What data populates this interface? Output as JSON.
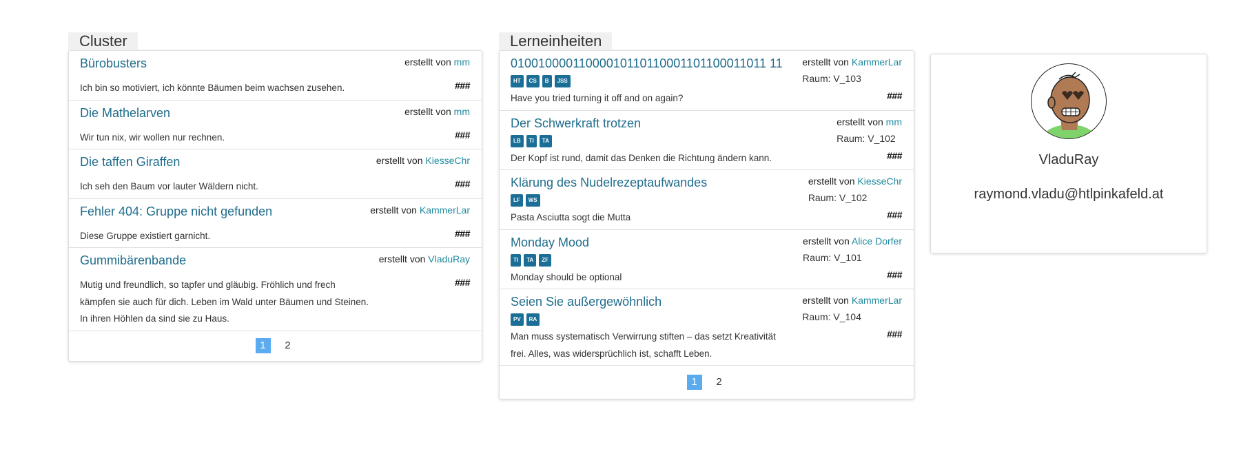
{
  "cluster": {
    "title": "Cluster",
    "created_by_label": "erstellt von",
    "items": [
      {
        "title": "Bürobusters",
        "creator": "mm",
        "desc": "Ich bin so motiviert, ich könnte Bäumen beim wachsen zusehen.",
        "hash": "###"
      },
      {
        "title": "Die Mathelarven",
        "creator": "mm",
        "desc": "Wir tun nix, wir wollen nur rechnen.",
        "hash": "###"
      },
      {
        "title": "Die taffen Giraffen",
        "creator": "KiesseChr",
        "desc": "Ich seh den Baum vor lauter Wäldern nicht.",
        "hash": "###"
      },
      {
        "title": "Fehler 404: Gruppe nicht gefunden",
        "creator": "KammerLar",
        "desc": "Diese Gruppe existiert garnicht.",
        "hash": "###"
      },
      {
        "title": "Gummibärenbande",
        "creator": "VladuRay",
        "desc": "Mutig und freundlich, so tapfer und gläubig. Fröhlich und frech kämpfen sie auch für dich. Leben im Wald unter Bäumen und Steinen. In ihren Höhlen da sind sie zu Haus.",
        "hash": "###"
      }
    ],
    "pages": [
      "1",
      "2"
    ]
  },
  "lern": {
    "title": "Lerneinheiten",
    "created_by_label": "erstellt von",
    "room_label": "Raum:",
    "items": [
      {
        "title": "01001000011000010110110001101100011011 11",
        "creator": "KammerLar",
        "room": "V_103",
        "tags": [
          "HT",
          "CS",
          "B",
          "JSS"
        ],
        "desc": "Have you tried turning it off and on again?",
        "hash": "###"
      },
      {
        "title": "Der Schwerkraft trotzen",
        "creator": "mm",
        "room": "V_102",
        "tags": [
          "LB",
          "TI",
          "TA"
        ],
        "desc": "Der Kopf ist rund, damit das Denken die Richtung ändern kann.",
        "hash": "###"
      },
      {
        "title": "Klärung des Nudelrezeptaufwandes",
        "creator": "KiesseChr",
        "room": "V_102",
        "tags": [
          "LF",
          "WS"
        ],
        "desc": "Pasta Asciutta sogt die Mutta",
        "hash": "###"
      },
      {
        "title": "Monday Mood",
        "creator": "Alice Dorfer",
        "room": "V_101",
        "tags": [
          "TI",
          "TA",
          "ZF"
        ],
        "desc": "Monday should be optional",
        "hash": "###"
      },
      {
        "title": "Seien Sie außergewöhnlich",
        "creator": "KammerLar",
        "room": "V_104",
        "tags": [
          "PV",
          "RA"
        ],
        "desc": "Man muss systematisch Verwirrung stiften – das setzt Kreativität frei. Alles, was widersprüchlich ist, schafft Leben.",
        "hash": "###"
      }
    ],
    "pages": [
      "1",
      "2"
    ]
  },
  "profile": {
    "username": "VladuRay",
    "email": "raymond.vladu@htlpinkafeld.at"
  }
}
